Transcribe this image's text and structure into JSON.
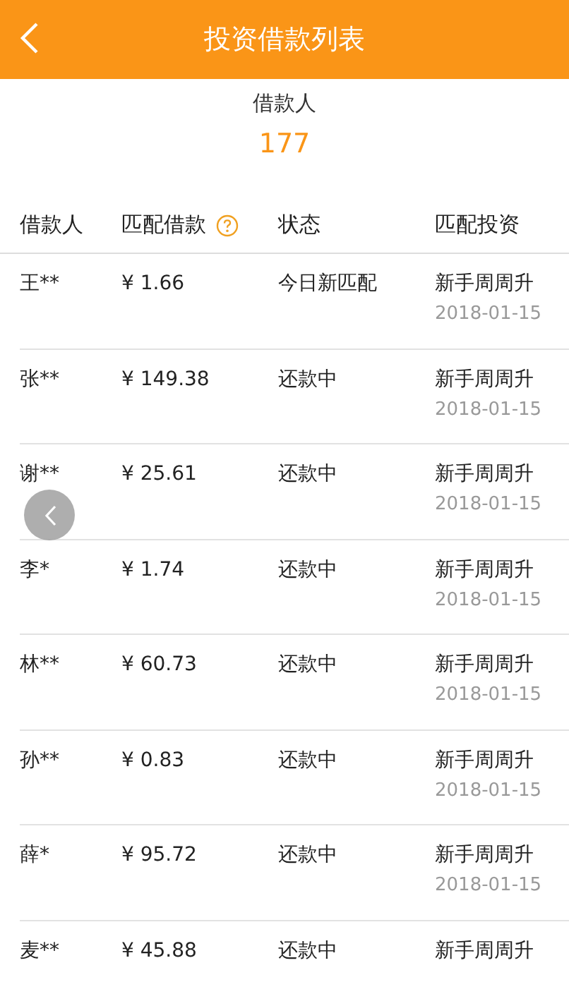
{
  "header": {
    "title": "投资借款列表"
  },
  "summary": {
    "label": "借款人",
    "count": "177"
  },
  "table": {
    "columns": [
      "借款人",
      "匹配借款",
      "状态",
      "匹配投资"
    ],
    "rows": [
      {
        "name": "王**",
        "amount": "¥ 1.66",
        "status": "今日新匹配",
        "plan": "新手周周升",
        "date": "2018-01-15"
      },
      {
        "name": "张**",
        "amount": "¥ 149.38",
        "status": "还款中",
        "plan": "新手周周升",
        "date": "2018-01-15"
      },
      {
        "name": "谢**",
        "amount": "¥ 25.61",
        "status": "还款中",
        "plan": "新手周周升",
        "date": "2018-01-15"
      },
      {
        "name": "李*",
        "amount": "¥ 1.74",
        "status": "还款中",
        "plan": "新手周周升",
        "date": "2018-01-15"
      },
      {
        "name": "林**",
        "amount": "¥ 60.73",
        "status": "还款中",
        "plan": "新手周周升",
        "date": "2018-01-15"
      },
      {
        "name": "孙**",
        "amount": "¥ 0.83",
        "status": "还款中",
        "plan": "新手周周升",
        "date": "2018-01-15"
      },
      {
        "name": "薛*",
        "amount": "¥ 95.72",
        "status": "还款中",
        "plan": "新手周周升",
        "date": "2018-01-15"
      },
      {
        "name": "麦**",
        "amount": "¥ 45.88",
        "status": "还款中",
        "plan": "新手周周升"
      }
    ]
  }
}
